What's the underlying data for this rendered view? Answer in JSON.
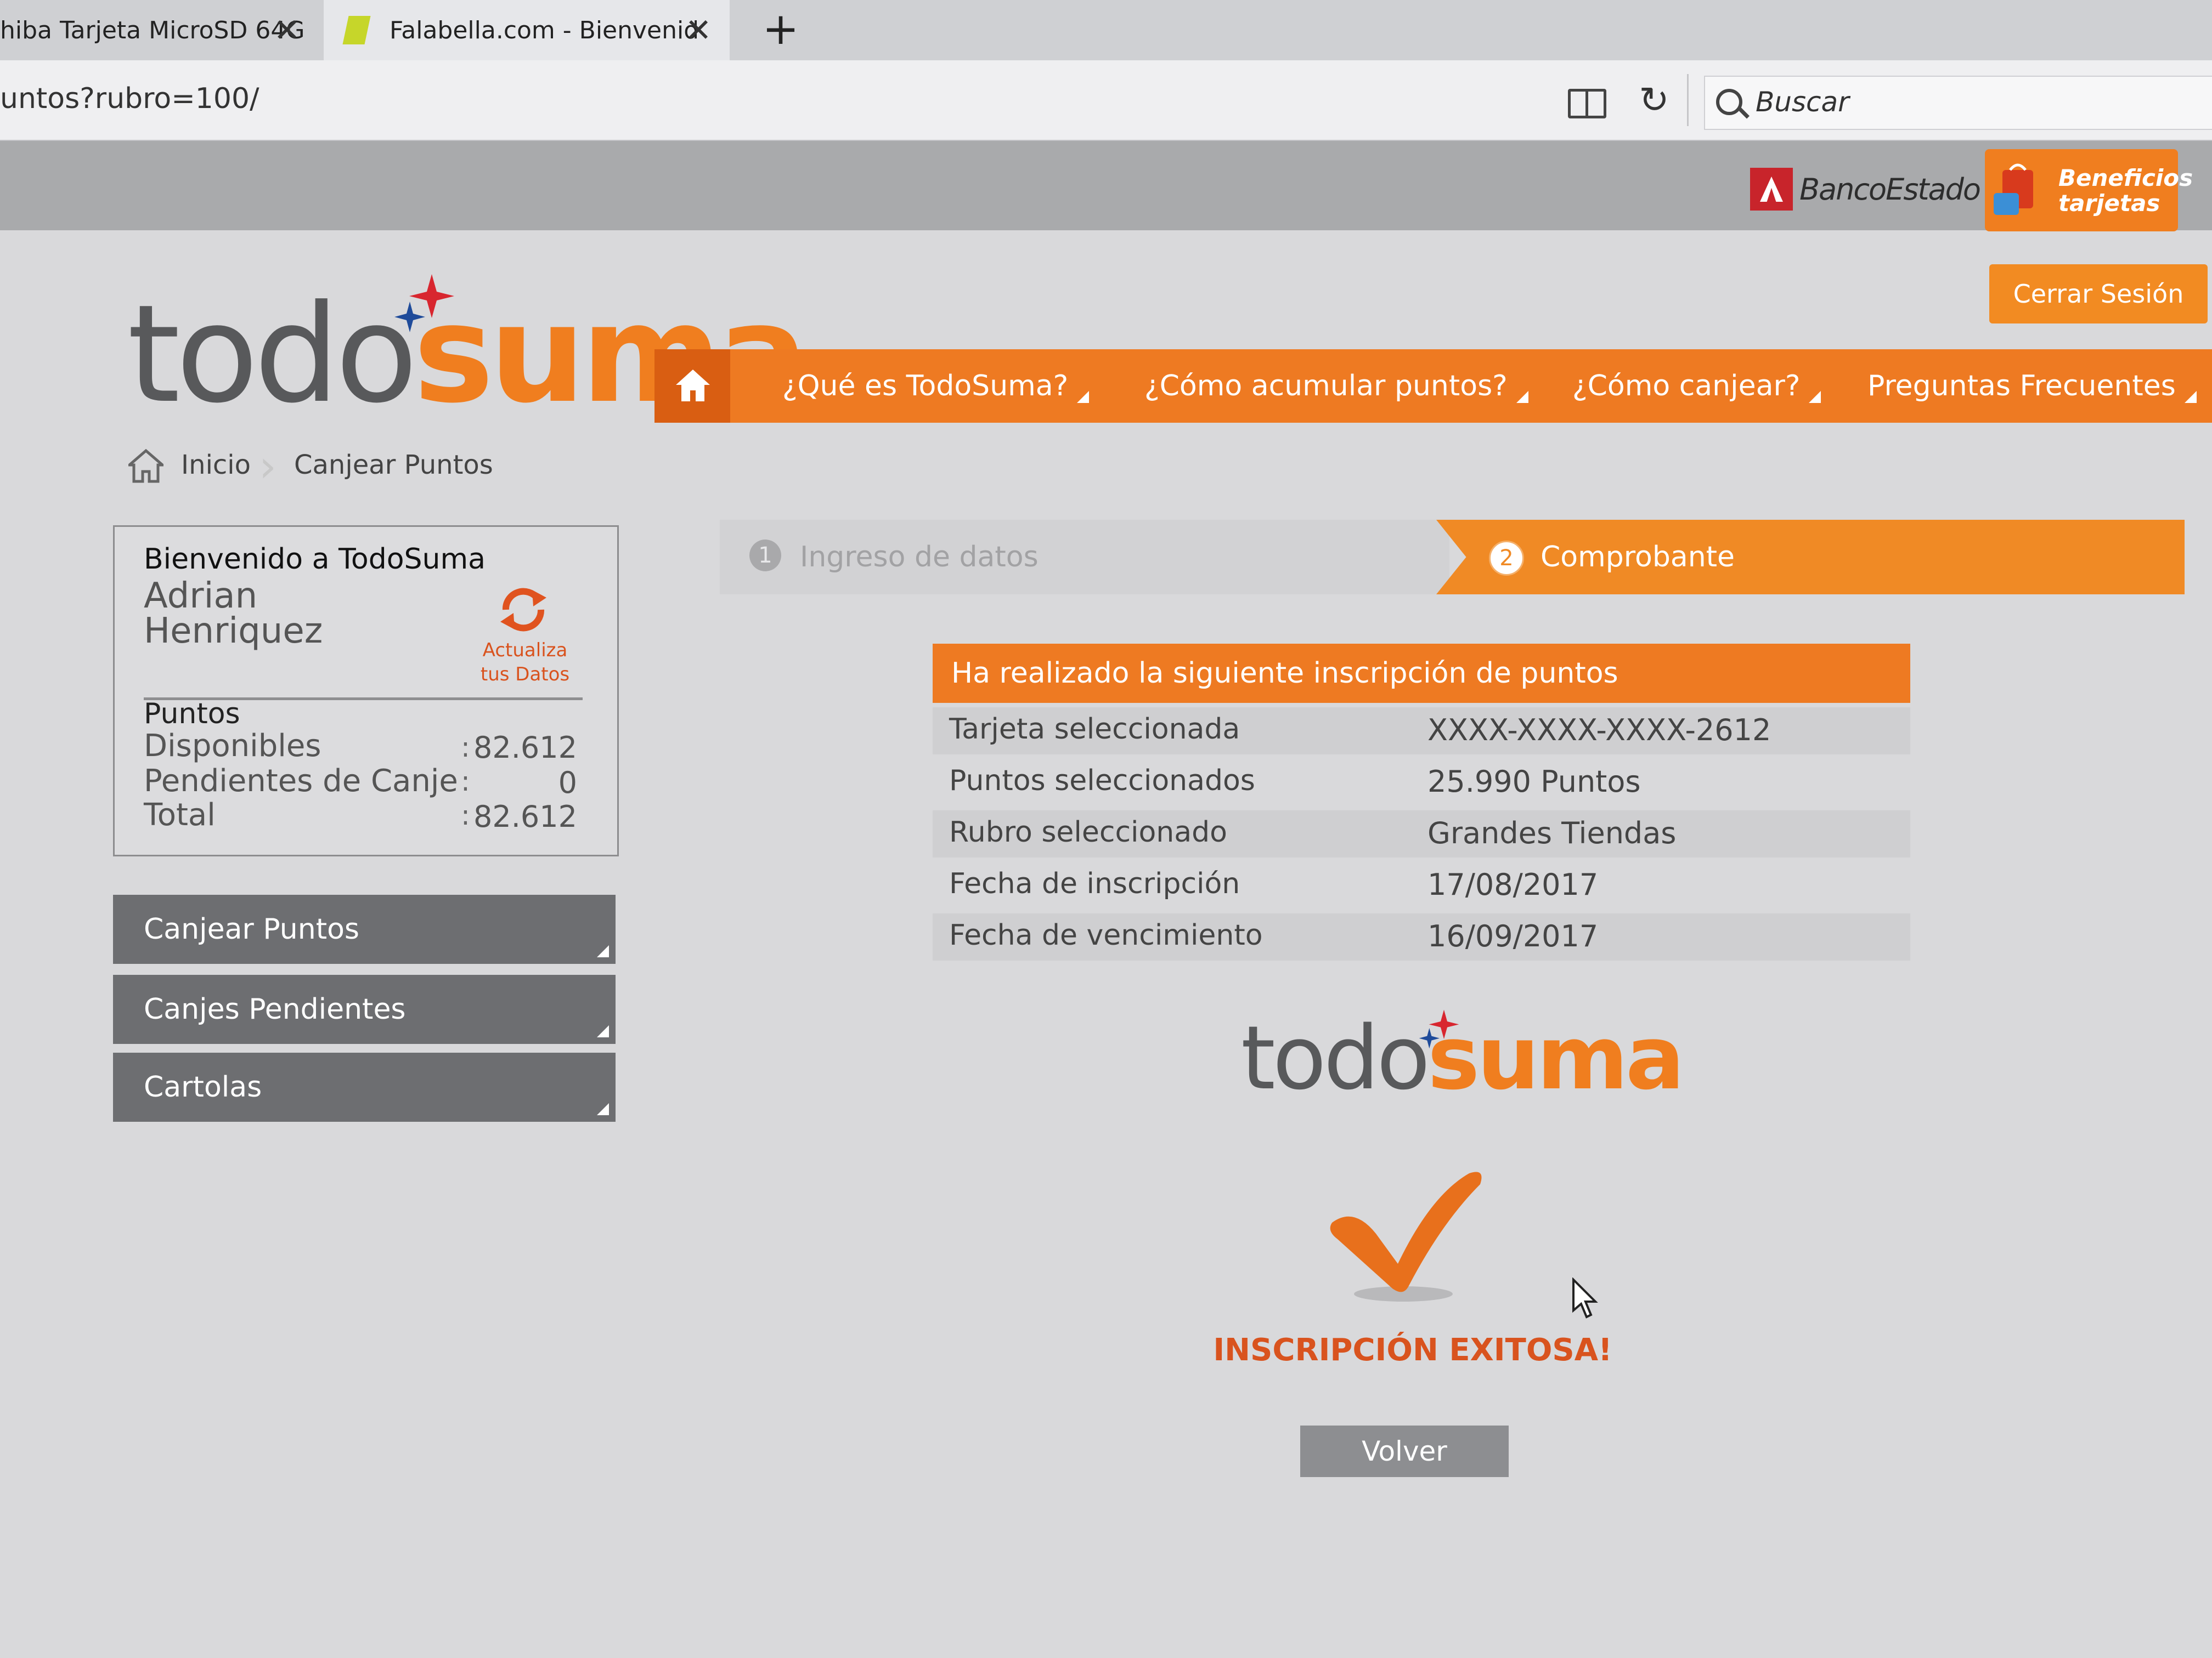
{
  "browser": {
    "tabs": [
      {
        "title": "hiba Tarjeta MicroSD 64G"
      },
      {
        "title": "Falabella.com - Bienvenidos"
      }
    ],
    "url": "untos?rubro=100/",
    "search_placeholder": "Buscar"
  },
  "site": {
    "bank_name": "BancoEstado",
    "benefits_label": "Beneficios tarjetas",
    "logout_label": "Cerrar Sesión",
    "logo": {
      "part1": "todo",
      "part2": "suma"
    },
    "nav": [
      {
        "label": "¿Qué es TodoSuma?"
      },
      {
        "label": "¿Cómo acumular puntos?"
      },
      {
        "label": "¿Cómo canjear?"
      },
      {
        "label": "Preguntas Frecuentes"
      }
    ],
    "breadcrumb": {
      "home": "Inicio",
      "current": "Canjear Puntos"
    }
  },
  "welcome": {
    "title": "Bienvenido a TodoSuma",
    "name_line1": "Adrian",
    "name_line2": "Henriquez",
    "update_line1": "Actualiza",
    "update_line2": "tus Datos",
    "points_title": "Puntos",
    "points": [
      {
        "label": "Disponibles",
        "colon": ":",
        "value": "82.612"
      },
      {
        "label": "Pendientes de Canje",
        "colon": ":",
        "value": "0"
      },
      {
        "label": "Total",
        "colon": ":",
        "value": "82.612"
      }
    ]
  },
  "sidebar": {
    "buttons": [
      {
        "label": "Canjear Puntos"
      },
      {
        "label": "Canjes Pendientes"
      },
      {
        "label": "Cartolas"
      }
    ]
  },
  "steps": [
    {
      "num": "1",
      "label": "Ingreso de datos",
      "active": false
    },
    {
      "num": "2",
      "label": "Comprobante",
      "active": true
    }
  ],
  "receipt": {
    "header": "Ha realizado la siguiente inscripción de puntos",
    "rows": [
      {
        "label": "Tarjeta seleccionada",
        "value": "XXXX-XXXX-XXXX-2612"
      },
      {
        "label": "Puntos seleccionados",
        "value": "25.990 Puntos"
      },
      {
        "label": "Rubro seleccionado",
        "value": "Grandes Tiendas"
      },
      {
        "label": "Fecha de inscripción",
        "value": "17/08/2017"
      },
      {
        "label": "Fecha de vencimiento",
        "value": "16/09/2017"
      }
    ]
  },
  "success_message": "INSCRIPCIÓN EXITOSA!",
  "back_button": "Volver",
  "colors": {
    "brand_orange": "#ee7a22",
    "success_text": "#d9531e",
    "button_gray": "#6d6e71"
  },
  "icons": [
    "close-icon",
    "plus-icon",
    "reader-view-icon",
    "reload-icon",
    "search-icon",
    "home-icon",
    "refresh-icon",
    "checkmark-icon",
    "cursor-icon"
  ]
}
